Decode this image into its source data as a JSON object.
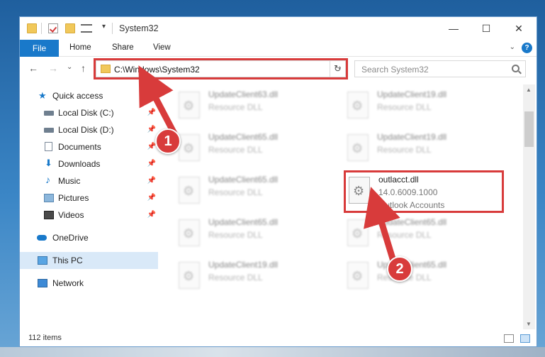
{
  "window": {
    "title": "System32",
    "minimize_glyph": "—",
    "maximize_glyph": "☐",
    "close_glyph": "✕"
  },
  "ribbon": {
    "tabs": [
      "File",
      "Home",
      "Share",
      "View"
    ],
    "expand_glyph": "⌄",
    "help_glyph": "?"
  },
  "address": {
    "path": "C:\\Windows\\System32",
    "search_placeholder": "Search System32",
    "back_glyph": "←",
    "forward_glyph": "→",
    "recent_glyph": "⌄",
    "up_glyph": "↑",
    "dropdown_glyph": "⌄",
    "refresh_glyph": "↻"
  },
  "nav_pane": {
    "quick_access": "Quick access",
    "items": [
      {
        "label": "Local Disk (C:)",
        "icon": "drive-icon",
        "pinned": true
      },
      {
        "label": "Local Disk (D:)",
        "icon": "drive-icon",
        "pinned": true
      },
      {
        "label": "Documents",
        "icon": "documents-icon",
        "pinned": true
      },
      {
        "label": "Downloads",
        "icon": "downloads-icon",
        "pinned": true
      },
      {
        "label": "Music",
        "icon": "music-icon",
        "pinned": true
      },
      {
        "label": "Pictures",
        "icon": "pictures-icon",
        "pinned": true
      },
      {
        "label": "Videos",
        "icon": "videos-icon",
        "pinned": true
      }
    ],
    "onedrive": "OneDrive",
    "this_pc": "This PC",
    "network": "Network",
    "pin_glyph": "📌"
  },
  "files": {
    "left": [
      {
        "name": "UpdateClient63.dll",
        "type": "Resource DLL"
      },
      {
        "name": "UpdateClient65.dll",
        "type": "Resource DLL"
      },
      {
        "name": "UpdateClient65.dll",
        "type": "Resource DLL"
      },
      {
        "name": "UpdateClient65.dll",
        "type": "Resource DLL"
      },
      {
        "name": "UpdateClient19.dll",
        "type": "Resource DLL"
      }
    ],
    "right": [
      {
        "name": "UpdateClient19.dll",
        "type": "Resource DLL"
      },
      {
        "name": "UpdateClient19.dll",
        "type": "Resource DLL"
      },
      {
        "name": "UpdateClient65.dll",
        "type": "Resource DLL"
      },
      {
        "name": "UpdateClient65.dll",
        "type": "Resource DLL"
      }
    ],
    "highlighted": {
      "name": "outlacct.dll",
      "version": "14.0.6009.1000",
      "description": "Outlook Accounts"
    }
  },
  "status": {
    "item_count": "112 items"
  },
  "callouts": {
    "step1": "1",
    "step2": "2"
  },
  "colors": {
    "accent": "#1979ca",
    "highlight_red": "#d83b3b"
  }
}
